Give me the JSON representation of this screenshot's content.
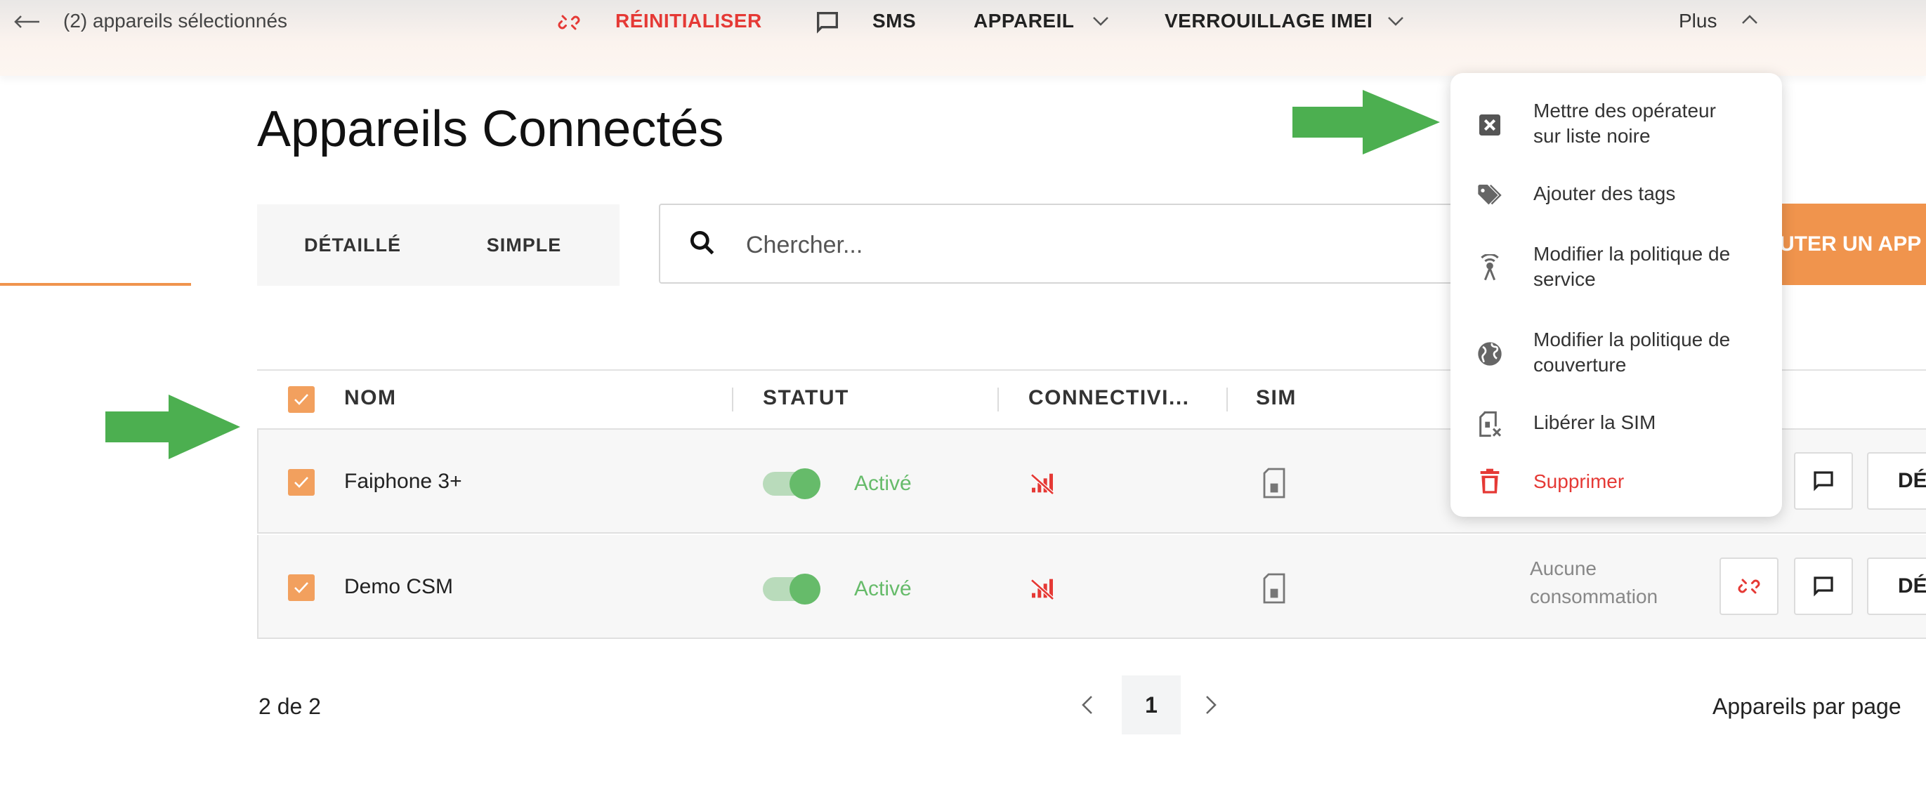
{
  "topbar": {
    "selection_label": "(2) appareils sélectionnés",
    "reset_label": "RÉINITIALISER",
    "sms_label": "SMS",
    "device_label": "APPAREIL",
    "imei_lock_label": "VERROUILLAGE IMEI",
    "more_label": "Plus"
  },
  "page": {
    "title": "Appareils Connectés"
  },
  "view_tabs": {
    "detailed": "DÉTAILLÉ",
    "simple": "SIMPLE",
    "active": "DÉTAILLÉ"
  },
  "search": {
    "placeholder": "Chercher..."
  },
  "add_button": {
    "label": "AJOUTER UN APPAREIL",
    "visible_label": "UTER UN APP"
  },
  "table": {
    "columns": [
      "NOM",
      "STATUT",
      "CONNECTIVI...",
      "SIM"
    ],
    "rows": [
      {
        "name": "Faiphone 3+",
        "status": "Activé",
        "consumption": "",
        "details_label": "DÉ"
      },
      {
        "name": "Demo CSM",
        "status": "Activé",
        "consumption_line1": "Aucune",
        "consumption_line2": "consommation",
        "details_label": "DÉ"
      }
    ]
  },
  "pagination": {
    "count_label": "2 de 2",
    "current_page": "1",
    "per_page_label": "Appareils par page"
  },
  "more_menu": {
    "items": [
      {
        "line1": "Mettre des opérateur",
        "line2": "sur liste noire",
        "icon": "blacklist-icon"
      },
      {
        "line1": "Ajouter des tags",
        "icon": "tags-icon"
      },
      {
        "line1": "Modifier la politique de",
        "line2": "service",
        "icon": "antenna-icon"
      },
      {
        "line1": "Modifier la politique de",
        "line2": "couverture",
        "icon": "globe-icon"
      },
      {
        "line1": "Libérer la SIM",
        "icon": "sim-release-icon"
      },
      {
        "line1": "Supprimer",
        "icon": "trash-icon",
        "danger": true
      }
    ]
  },
  "colors": {
    "accent": "#f0944d",
    "danger": "#e53935",
    "success": "#66bb6a",
    "annotation_arrow": "#4caf50"
  }
}
